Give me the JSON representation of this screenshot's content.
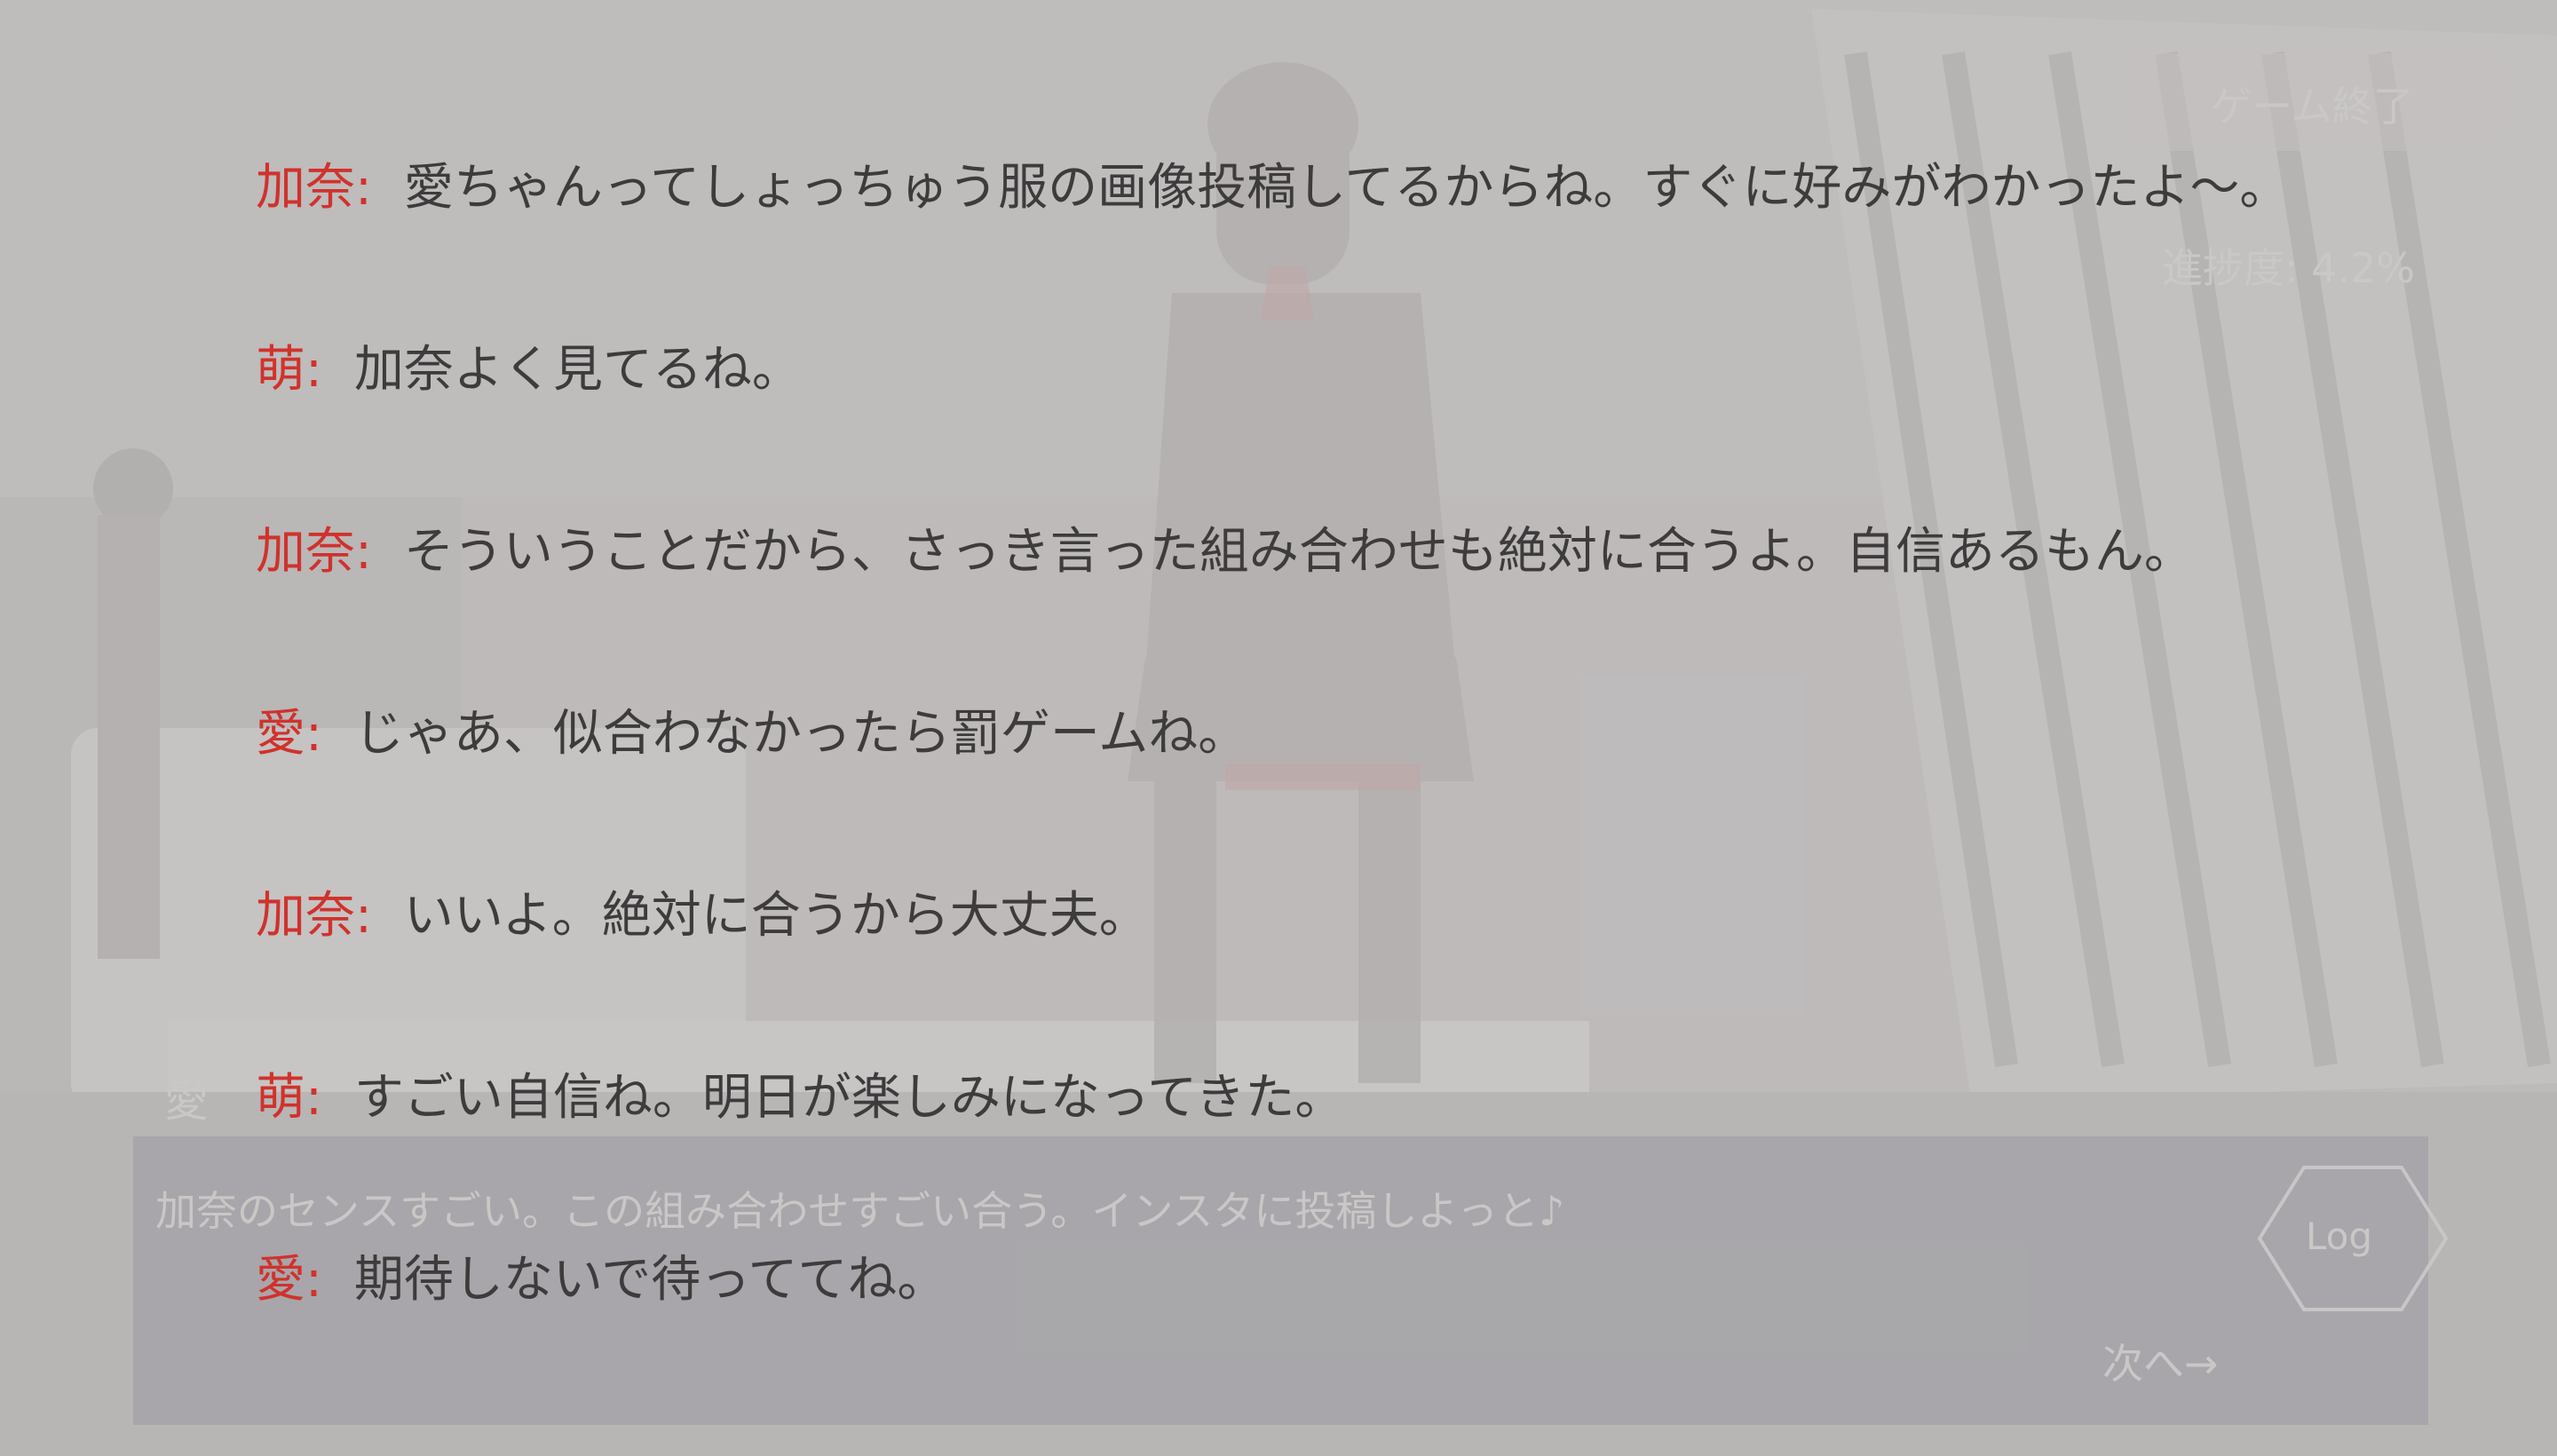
{
  "game": {
    "end_button_label": "ゲーム終了",
    "progress_label": "進捗度: 4.2%",
    "current_speaker": "愛",
    "current_dialog": "加奈のセンスすごい。この組み合わせすごい合う。インスタに投稿しよっと♪",
    "log_button_label": "Log",
    "next_button_label": "次へ→"
  },
  "backlog": [
    {
      "speaker": "加奈",
      "text": "愛ちゃんってしょっちゅう服の画像投稿してるからね。すぐに好みがわかったよ〜。"
    },
    {
      "speaker": "萌",
      "text": "加奈よく見てるね。"
    },
    {
      "speaker": "加奈",
      "text": "そういうことだから、さっき言った組み合わせも絶対に合うよ。自信あるもん。"
    },
    {
      "speaker": "愛",
      "text": "じゃあ、似合わなかったら罰ゲームね。"
    },
    {
      "speaker": "加奈",
      "text": "いいよ。絶対に合うから大丈夫。"
    },
    {
      "speaker": "萌",
      "text": "すごい自信ね。明日が楽しみになってきた。"
    },
    {
      "speaker": "愛",
      "text": "期待しないで待っててね。"
    }
  ],
  "colors": {
    "speaker": "#d0322c",
    "text": "#3d3b3b",
    "overlay": "#c3c0c0"
  }
}
